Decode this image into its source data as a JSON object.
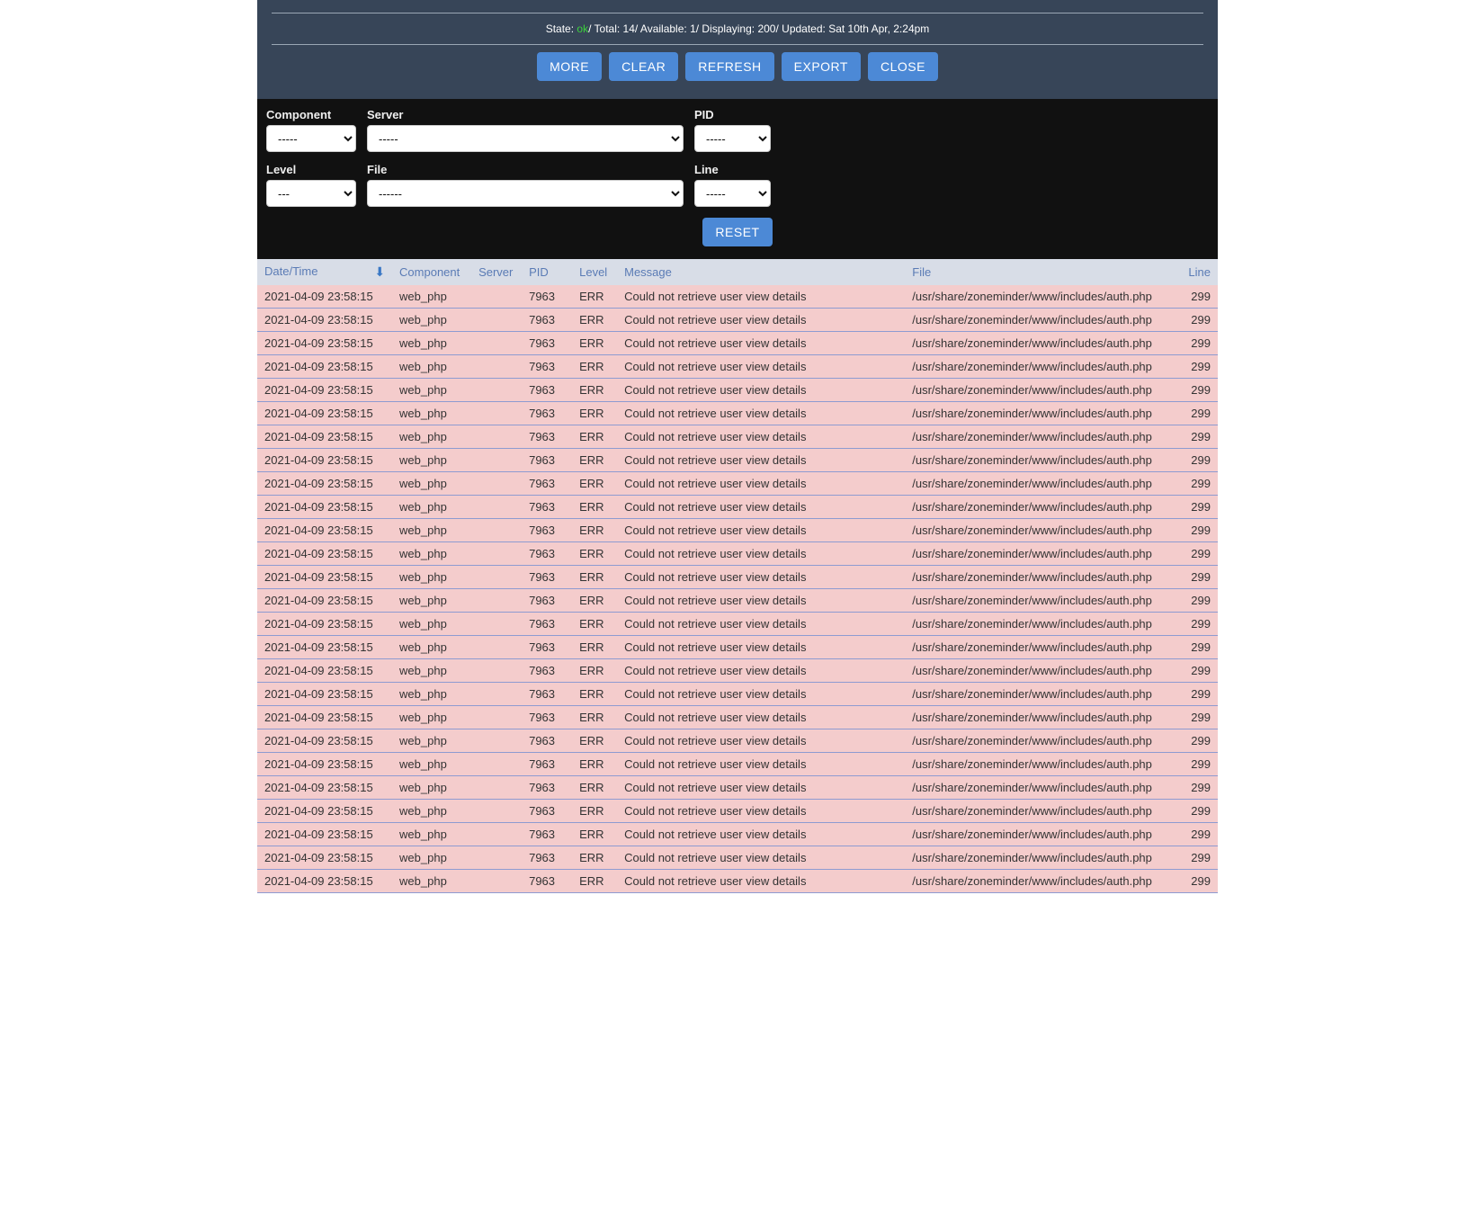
{
  "status": {
    "prefix": "State: ",
    "state": "ok",
    "text_total": "/ Total: ",
    "total": "14",
    "text_available": "/ Available: ",
    "available": "1",
    "text_displaying": "/ Displaying: ",
    "displaying": "200",
    "text_updated": "/ Updated: ",
    "updated": "Sat 10th Apr, 2:24pm"
  },
  "buttons": {
    "more": "MORE",
    "clear": "CLEAR",
    "refresh": "REFRESH",
    "export": "EXPORT",
    "close": "CLOSE",
    "reset": "RESET"
  },
  "filters": {
    "component": {
      "label": "Component",
      "value": "-----"
    },
    "server": {
      "label": "Server",
      "value": "-----"
    },
    "pid": {
      "label": "PID",
      "value": "-----"
    },
    "level": {
      "label": "Level",
      "value": "---"
    },
    "file": {
      "label": "File",
      "value": "------"
    },
    "line": {
      "label": "Line",
      "value": "-----"
    }
  },
  "table": {
    "headers": {
      "datetime": "Date/Time",
      "component": "Component",
      "server": "Server",
      "pid": "PID",
      "level": "Level",
      "message": "Message",
      "file": "File",
      "line": "Line"
    },
    "sort_glyph": "⬇",
    "row_template": {
      "datetime": "2021-04-09 23:58:15",
      "component": "web_php",
      "server": "",
      "pid": "7963",
      "level": "ERR",
      "message": "Could not retrieve user view details",
      "file": "/usr/share/zoneminder/www/includes/auth.php",
      "line": "299"
    },
    "row_count": 26
  }
}
